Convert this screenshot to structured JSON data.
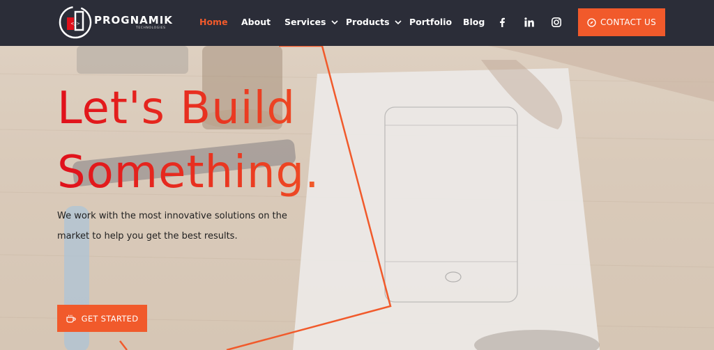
{
  "brand": {
    "name": "PROGNAMIK",
    "tagline": "TECHNOLOGIES",
    "logo_glyph": "</>",
    "accent_color": "#f15a2b",
    "header_bg": "#2b2d38"
  },
  "nav": {
    "items": [
      {
        "label": "Home",
        "active": true
      },
      {
        "label": "About"
      },
      {
        "label": "Services",
        "has_dropdown": true
      },
      {
        "label": "Products",
        "has_dropdown": true
      },
      {
        "label": "Portfolio"
      },
      {
        "label": "Blog"
      }
    ],
    "social_icons": [
      "facebook-icon",
      "linkedin-icon",
      "instagram-icon"
    ],
    "contact_label": "CONTACT US",
    "contact_icon": "compass-icon"
  },
  "hero": {
    "headline_line1": "Let's Build",
    "headline_line2": "Something",
    "headline_dot": ".",
    "subtext": "We work with the most innovative solutions on the market to help you get the best results.",
    "cta_label": "GET STARTED",
    "cta_icon": "coffee-cup-icon"
  }
}
